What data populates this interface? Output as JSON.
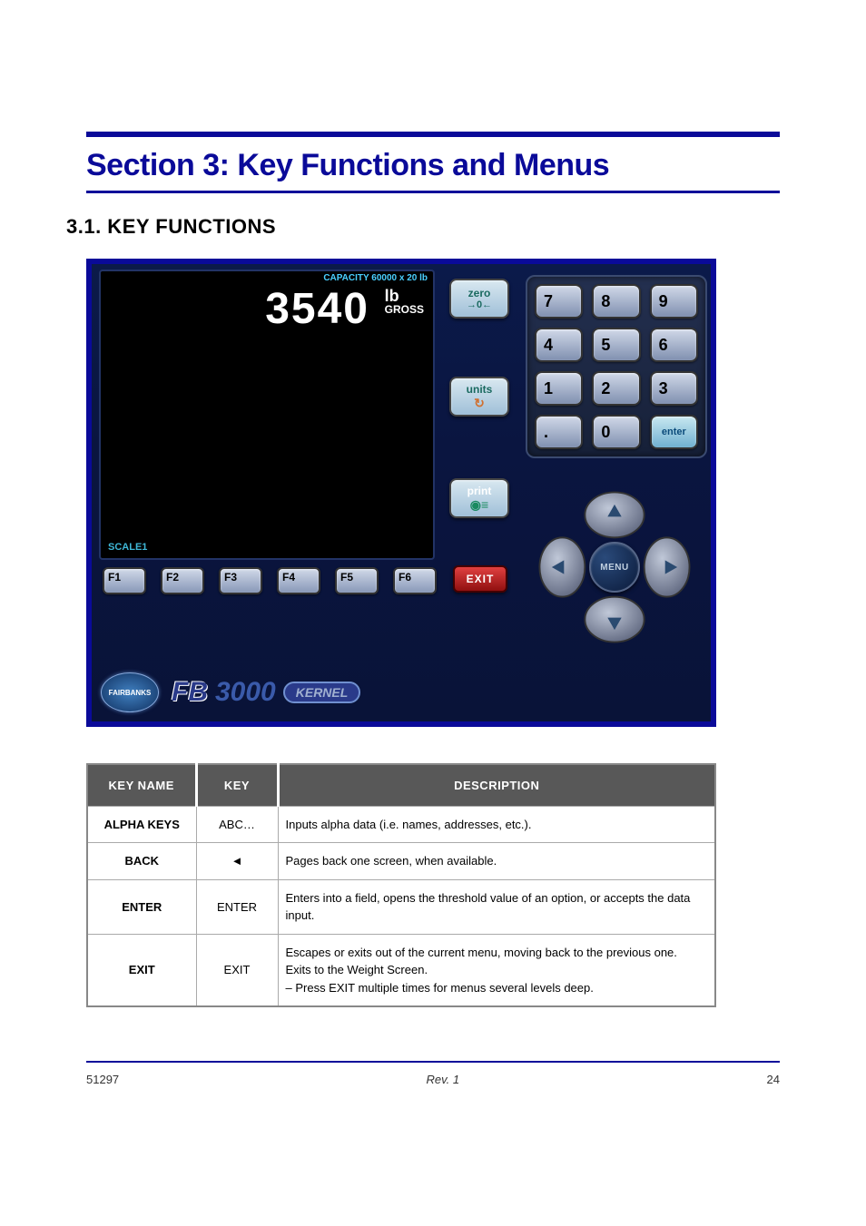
{
  "section_title": "Section 3: Key Functions and Menus",
  "subtitle": "3.1.  KEY FUNCTIONS",
  "device": {
    "capacity": "CAPACITY 60000 x 20 lb",
    "readout": "3540",
    "unit_lb": "lb",
    "unit_gross": "GROSS",
    "scale": "SCALE1",
    "btn_zero": "zero",
    "btn_units": "units",
    "btn_print": "print",
    "btn_exit": "EXIT",
    "btn_menu": "MENU",
    "keypad": {
      "7": "7",
      "8": "8",
      "9": "9",
      "4": "4",
      "5": "5",
      "6": "6",
      "1": "1",
      "2": "2",
      "3": "3",
      "dot": ".",
      "0": "0",
      "enter": "enter"
    },
    "fkeys": [
      "F1",
      "F2",
      "F3",
      "F4",
      "F5",
      "F6"
    ],
    "brand": {
      "logo": "FAIRBANKS",
      "fb": "FB",
      "num": "3000",
      "kernel": "KERNEL"
    }
  },
  "table": {
    "headers": [
      "KEY NAME",
      "KEY",
      "DESCRIPTION"
    ],
    "rows": [
      {
        "name": "ALPHA KEYS",
        "key": "ABC…",
        "desc": "Inputs alpha data (i.e. names, addresses, etc.)."
      },
      {
        "name": "BACK",
        "key": "◄",
        "desc": "Pages back one screen, when available."
      },
      {
        "name": "ENTER",
        "key": "ENTER",
        "desc": "Enters into a field, opens the threshold value of an option, or accepts the data input."
      },
      {
        "name": "EXIT",
        "key": "EXIT",
        "desc": "Escapes or exits out of the current menu, moving back to the previous one.\nExits to the Weight Screen.\n–  Press EXIT multiple times for menus several levels deep."
      }
    ]
  },
  "footer": {
    "left": "51297",
    "mid": "Rev. 1",
    "right": "24"
  }
}
